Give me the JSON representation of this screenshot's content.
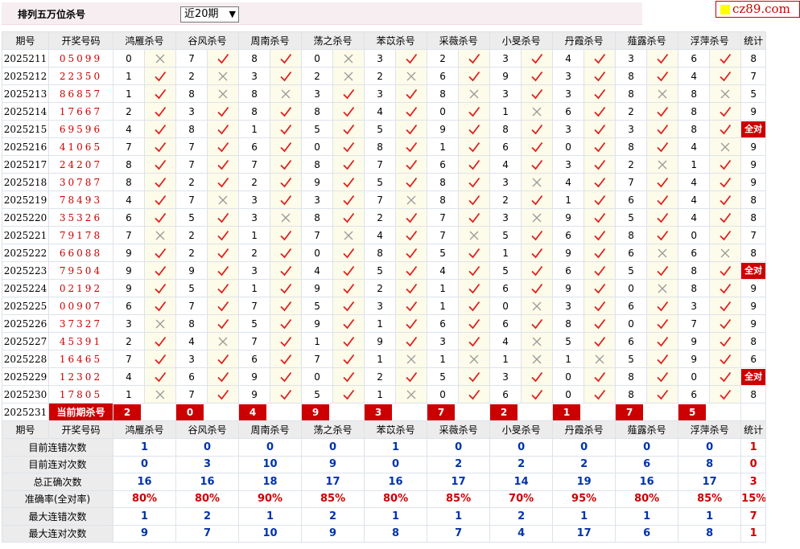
{
  "header": {
    "title": "排列五万位杀号",
    "period_selected": "近20期",
    "logo_text": "cz89.com"
  },
  "columns": {
    "period": "期号",
    "number": "开奖号码",
    "tally": "统计",
    "experts": [
      "鸿雁杀号",
      "谷风杀号",
      "周南杀号",
      "荡之杀号",
      "苯苡杀号",
      "采薇杀号",
      "小旻杀号",
      "丹霞杀号",
      "薤露杀号",
      "浮萍杀号"
    ]
  },
  "all_right_label": "全对",
  "rows": [
    {
      "period": "2025211",
      "number": "05099",
      "picks": [
        [
          "0",
          "x"
        ],
        [
          "7",
          "v"
        ],
        [
          "8",
          "v"
        ],
        [
          "0",
          "x"
        ],
        [
          "3",
          "v"
        ],
        [
          "2",
          "v"
        ],
        [
          "3",
          "v"
        ],
        [
          "4",
          "v"
        ],
        [
          "3",
          "v"
        ],
        [
          "6",
          "v"
        ]
      ],
      "tally": "8"
    },
    {
      "period": "2025212",
      "number": "22350",
      "picks": [
        [
          "1",
          "v"
        ],
        [
          "2",
          "x"
        ],
        [
          "3",
          "v"
        ],
        [
          "2",
          "x"
        ],
        [
          "2",
          "x"
        ],
        [
          "6",
          "v"
        ],
        [
          "9",
          "v"
        ],
        [
          "3",
          "v"
        ],
        [
          "8",
          "v"
        ],
        [
          "4",
          "v"
        ]
      ],
      "tally": "7"
    },
    {
      "period": "2025213",
      "number": "86857",
      "picks": [
        [
          "1",
          "v"
        ],
        [
          "8",
          "x"
        ],
        [
          "8",
          "x"
        ],
        [
          "3",
          "v"
        ],
        [
          "3",
          "v"
        ],
        [
          "8",
          "x"
        ],
        [
          "3",
          "v"
        ],
        [
          "3",
          "v"
        ],
        [
          "8",
          "x"
        ],
        [
          "8",
          "x"
        ]
      ],
      "tally": "5"
    },
    {
      "period": "2025214",
      "number": "17667",
      "picks": [
        [
          "2",
          "v"
        ],
        [
          "3",
          "v"
        ],
        [
          "8",
          "v"
        ],
        [
          "8",
          "v"
        ],
        [
          "4",
          "v"
        ],
        [
          "0",
          "v"
        ],
        [
          "1",
          "x"
        ],
        [
          "6",
          "v"
        ],
        [
          "2",
          "v"
        ],
        [
          "8",
          "v"
        ]
      ],
      "tally": "9"
    },
    {
      "period": "2025215",
      "number": "69596",
      "picks": [
        [
          "4",
          "v"
        ],
        [
          "8",
          "v"
        ],
        [
          "1",
          "v"
        ],
        [
          "5",
          "v"
        ],
        [
          "5",
          "v"
        ],
        [
          "9",
          "v"
        ],
        [
          "8",
          "v"
        ],
        [
          "3",
          "v"
        ],
        [
          "3",
          "v"
        ],
        [
          "8",
          "v"
        ]
      ],
      "tally": "全对"
    },
    {
      "period": "2025216",
      "number": "41065",
      "picks": [
        [
          "7",
          "v"
        ],
        [
          "7",
          "v"
        ],
        [
          "6",
          "v"
        ],
        [
          "0",
          "v"
        ],
        [
          "8",
          "v"
        ],
        [
          "1",
          "v"
        ],
        [
          "6",
          "v"
        ],
        [
          "0",
          "v"
        ],
        [
          "8",
          "v"
        ],
        [
          "4",
          "x"
        ]
      ],
      "tally": "9"
    },
    {
      "period": "2025217",
      "number": "24207",
      "picks": [
        [
          "8",
          "v"
        ],
        [
          "7",
          "v"
        ],
        [
          "7",
          "v"
        ],
        [
          "8",
          "v"
        ],
        [
          "7",
          "v"
        ],
        [
          "6",
          "v"
        ],
        [
          "4",
          "v"
        ],
        [
          "3",
          "v"
        ],
        [
          "2",
          "x"
        ],
        [
          "1",
          "v"
        ]
      ],
      "tally": "9"
    },
    {
      "period": "2025218",
      "number": "30787",
      "picks": [
        [
          "8",
          "v"
        ],
        [
          "2",
          "v"
        ],
        [
          "2",
          "v"
        ],
        [
          "9",
          "v"
        ],
        [
          "5",
          "v"
        ],
        [
          "8",
          "v"
        ],
        [
          "3",
          "x"
        ],
        [
          "4",
          "v"
        ],
        [
          "7",
          "v"
        ],
        [
          "4",
          "v"
        ]
      ],
      "tally": "9"
    },
    {
      "period": "2025219",
      "number": "78493",
      "picks": [
        [
          "4",
          "v"
        ],
        [
          "7",
          "x"
        ],
        [
          "3",
          "v"
        ],
        [
          "3",
          "v"
        ],
        [
          "7",
          "x"
        ],
        [
          "8",
          "v"
        ],
        [
          "2",
          "v"
        ],
        [
          "1",
          "v"
        ],
        [
          "6",
          "v"
        ],
        [
          "4",
          "v"
        ]
      ],
      "tally": "8"
    },
    {
      "period": "2025220",
      "number": "35326",
      "picks": [
        [
          "6",
          "v"
        ],
        [
          "5",
          "v"
        ],
        [
          "3",
          "x"
        ],
        [
          "8",
          "v"
        ],
        [
          "2",
          "v"
        ],
        [
          "7",
          "v"
        ],
        [
          "3",
          "x"
        ],
        [
          "9",
          "v"
        ],
        [
          "5",
          "v"
        ],
        [
          "4",
          "v"
        ]
      ],
      "tally": "8"
    },
    {
      "period": "2025221",
      "number": "79178",
      "picks": [
        [
          "7",
          "x"
        ],
        [
          "2",
          "v"
        ],
        [
          "1",
          "v"
        ],
        [
          "7",
          "x"
        ],
        [
          "4",
          "v"
        ],
        [
          "7",
          "x"
        ],
        [
          "5",
          "v"
        ],
        [
          "6",
          "v"
        ],
        [
          "8",
          "v"
        ],
        [
          "0",
          "v"
        ]
      ],
      "tally": "7"
    },
    {
      "period": "2025222",
      "number": "66088",
      "picks": [
        [
          "9",
          "v"
        ],
        [
          "2",
          "v"
        ],
        [
          "2",
          "v"
        ],
        [
          "0",
          "v"
        ],
        [
          "8",
          "v"
        ],
        [
          "5",
          "v"
        ],
        [
          "1",
          "v"
        ],
        [
          "9",
          "v"
        ],
        [
          "6",
          "x"
        ],
        [
          "6",
          "x"
        ]
      ],
      "tally": "8"
    },
    {
      "period": "2025223",
      "number": "79504",
      "picks": [
        [
          "9",
          "v"
        ],
        [
          "9",
          "v"
        ],
        [
          "3",
          "v"
        ],
        [
          "4",
          "v"
        ],
        [
          "5",
          "v"
        ],
        [
          "4",
          "v"
        ],
        [
          "5",
          "v"
        ],
        [
          "6",
          "v"
        ],
        [
          "5",
          "v"
        ],
        [
          "8",
          "v"
        ]
      ],
      "tally": "全对"
    },
    {
      "period": "2025224",
      "number": "02192",
      "picks": [
        [
          "9",
          "v"
        ],
        [
          "5",
          "v"
        ],
        [
          "1",
          "v"
        ],
        [
          "9",
          "v"
        ],
        [
          "2",
          "v"
        ],
        [
          "1",
          "v"
        ],
        [
          "6",
          "v"
        ],
        [
          "9",
          "v"
        ],
        [
          "0",
          "x"
        ],
        [
          "8",
          "v"
        ]
      ],
      "tally": "9"
    },
    {
      "period": "2025225",
      "number": "00907",
      "picks": [
        [
          "6",
          "v"
        ],
        [
          "7",
          "v"
        ],
        [
          "7",
          "v"
        ],
        [
          "5",
          "v"
        ],
        [
          "3",
          "v"
        ],
        [
          "1",
          "v"
        ],
        [
          "0",
          "x"
        ],
        [
          "3",
          "v"
        ],
        [
          "6",
          "v"
        ],
        [
          "3",
          "v"
        ]
      ],
      "tally": "9"
    },
    {
      "period": "2025226",
      "number": "37327",
      "picks": [
        [
          "3",
          "x"
        ],
        [
          "8",
          "v"
        ],
        [
          "5",
          "v"
        ],
        [
          "9",
          "v"
        ],
        [
          "1",
          "v"
        ],
        [
          "6",
          "v"
        ],
        [
          "6",
          "v"
        ],
        [
          "8",
          "v"
        ],
        [
          "0",
          "v"
        ],
        [
          "7",
          "v"
        ]
      ],
      "tally": "9"
    },
    {
      "period": "2025227",
      "number": "45391",
      "picks": [
        [
          "2",
          "v"
        ],
        [
          "4",
          "x"
        ],
        [
          "7",
          "v"
        ],
        [
          "1",
          "v"
        ],
        [
          "9",
          "v"
        ],
        [
          "3",
          "v"
        ],
        [
          "4",
          "x"
        ],
        [
          "5",
          "v"
        ],
        [
          "6",
          "v"
        ],
        [
          "9",
          "v"
        ]
      ],
      "tally": "8"
    },
    {
      "period": "2025228",
      "number": "16465",
      "picks": [
        [
          "7",
          "v"
        ],
        [
          "3",
          "v"
        ],
        [
          "6",
          "v"
        ],
        [
          "7",
          "v"
        ],
        [
          "1",
          "x"
        ],
        [
          "1",
          "x"
        ],
        [
          "1",
          "x"
        ],
        [
          "1",
          "x"
        ],
        [
          "5",
          "v"
        ],
        [
          "9",
          "v"
        ]
      ],
      "tally": "6"
    },
    {
      "period": "2025229",
      "number": "12302",
      "picks": [
        [
          "4",
          "v"
        ],
        [
          "6",
          "v"
        ],
        [
          "9",
          "v"
        ],
        [
          "0",
          "v"
        ],
        [
          "2",
          "v"
        ],
        [
          "5",
          "v"
        ],
        [
          "3",
          "v"
        ],
        [
          "0",
          "v"
        ],
        [
          "8",
          "v"
        ],
        [
          "0",
          "v"
        ]
      ],
      "tally": "全对"
    },
    {
      "period": "2025230",
      "number": "17805",
      "picks": [
        [
          "1",
          "x"
        ],
        [
          "7",
          "v"
        ],
        [
          "9",
          "v"
        ],
        [
          "5",
          "v"
        ],
        [
          "1",
          "x"
        ],
        [
          "0",
          "v"
        ],
        [
          "6",
          "v"
        ],
        [
          "0",
          "v"
        ],
        [
          "8",
          "v"
        ],
        [
          "6",
          "v"
        ]
      ],
      "tally": "8"
    }
  ],
  "current": {
    "period": "2025231",
    "label": "当前期杀号",
    "picks": [
      "2",
      "0",
      "4",
      "9",
      "3",
      "7",
      "2",
      "1",
      "7",
      "5"
    ]
  },
  "stats": [
    {
      "label": "目前连错次数",
      "values": [
        "1",
        "0",
        "0",
        "0",
        "1",
        "0",
        "0",
        "0",
        "0",
        "0"
      ],
      "tally": "1",
      "red": false
    },
    {
      "label": "目前连对次数",
      "values": [
        "0",
        "3",
        "10",
        "9",
        "0",
        "2",
        "2",
        "2",
        "6",
        "8"
      ],
      "tally": "0",
      "red": false
    },
    {
      "label": "总正确次数",
      "values": [
        "16",
        "16",
        "18",
        "17",
        "16",
        "17",
        "14",
        "19",
        "16",
        "17"
      ],
      "tally": "3",
      "red": false
    },
    {
      "label": "准确率(全对率)",
      "values": [
        "80%",
        "80%",
        "90%",
        "85%",
        "80%",
        "85%",
        "70%",
        "95%",
        "80%",
        "85%"
      ],
      "tally": "15%",
      "red": true
    },
    {
      "label": "最大连错次数",
      "values": [
        "1",
        "2",
        "1",
        "2",
        "1",
        "1",
        "2",
        "1",
        "1",
        "1"
      ],
      "tally": "7",
      "red": false
    },
    {
      "label": "最大连对次数",
      "values": [
        "9",
        "7",
        "10",
        "9",
        "8",
        "7",
        "4",
        "17",
        "6",
        "8"
      ],
      "tally": "1",
      "red": false
    }
  ],
  "colors": {
    "accent_red": "#cc0000",
    "stat_blue": "#0033aa",
    "mark_bg": "#fdfbe9",
    "header_bg": "#ececec"
  }
}
